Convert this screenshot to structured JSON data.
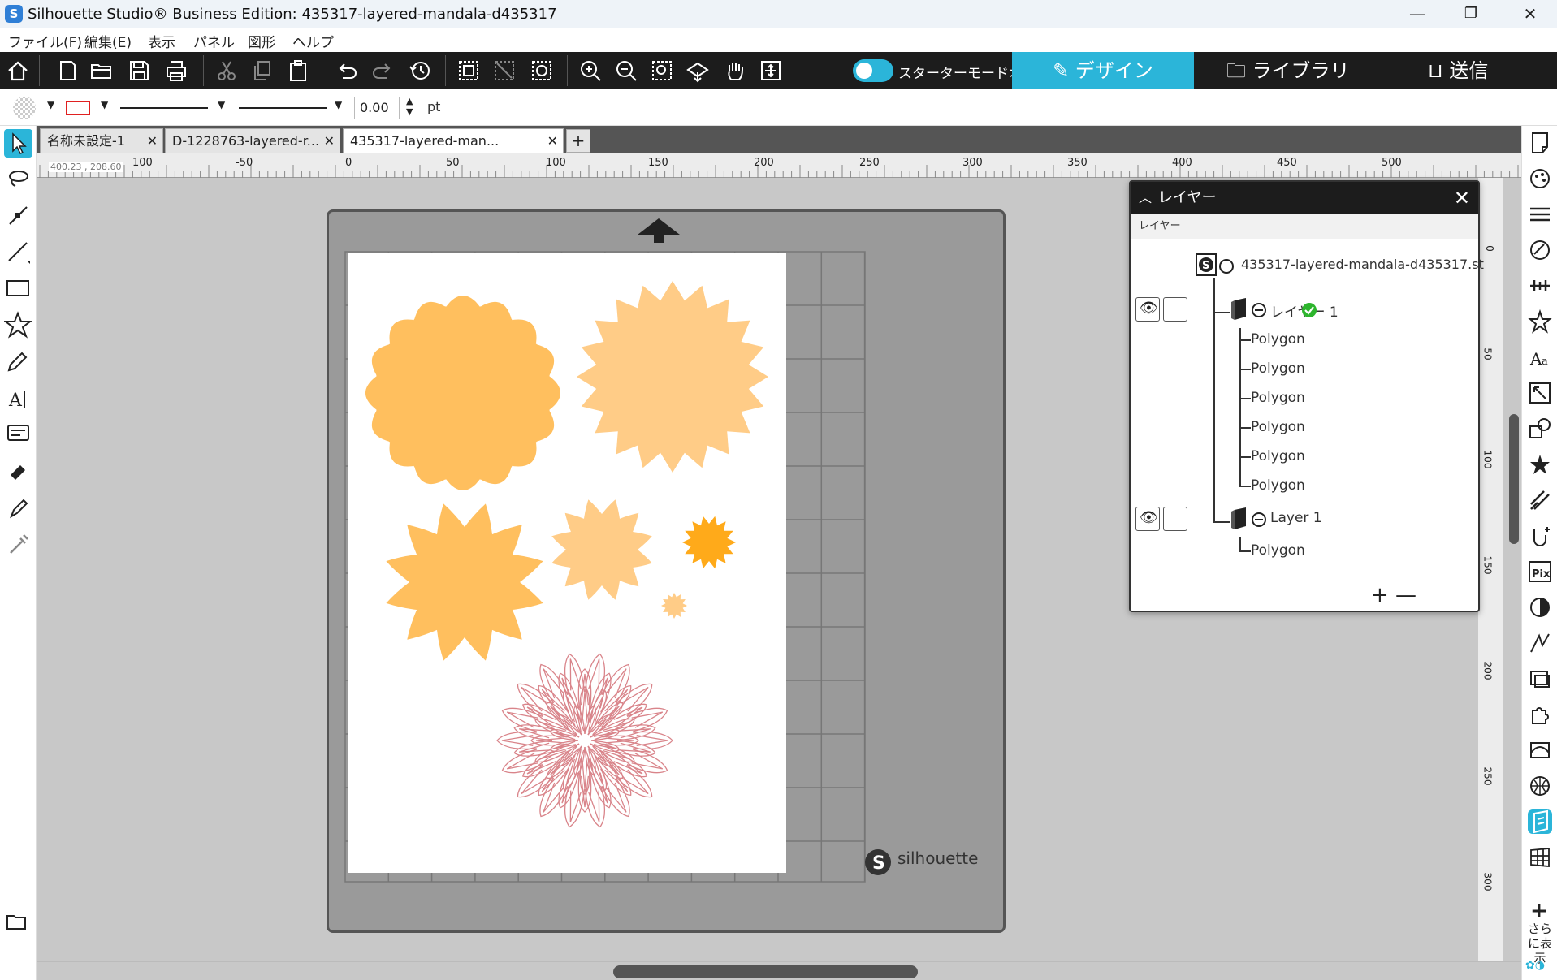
{
  "titlebar": {
    "title": "Silhouette Studio® Business Edition: 435317-layered-mandala-d435317",
    "minimize": "—",
    "maximize": "❐",
    "close": "✕"
  },
  "menu": {
    "file": "ファイル(F)",
    "edit": "編集(E)",
    "view": "表示",
    "panel": "パネル",
    "shape": "図形",
    "help": "ヘルプ"
  },
  "toolbar": {
    "starter_mode_label": "スターターモードオフ",
    "design": "デザイン",
    "library": "ライブラリ",
    "send": "送信"
  },
  "properties": {
    "line_width": "0.00",
    "unit": "pt"
  },
  "ruler": {
    "coordinate": "400.23 , 208.60",
    "h_ticks": [
      "100",
      "-50",
      "0",
      "50",
      "100",
      "150",
      "200",
      "250",
      "300",
      "350",
      "400",
      "450",
      "500"
    ],
    "v_ticks": [
      "0",
      "50",
      "100",
      "150",
      "200",
      "250",
      "300"
    ]
  },
  "doc_tabs": [
    {
      "label": "名称未設定-1",
      "active": false
    },
    {
      "label": "D-1228763-layered-r...",
      "active": false
    },
    {
      "label": "435317-layered-man...",
      "active": true
    }
  ],
  "add_tab": "+",
  "layers_panel": {
    "title": "レイヤー",
    "subtitle": "レイヤー",
    "file_name": "435317-layered-mandala-d435317.st",
    "layer1": {
      "name": "レイヤー 1",
      "children": [
        "Polygon",
        "Polygon",
        "Polygon",
        "Polygon",
        "Polygon",
        "Polygon"
      ]
    },
    "layer2": {
      "name": "Layer 1",
      "children": [
        "Polygon"
      ]
    },
    "add": "+",
    "remove": "—"
  },
  "mat": {
    "brand": "silhouette"
  },
  "right_panel": {
    "more_label": "さらに表示"
  },
  "colors": {
    "accent": "#2bb5d9",
    "toolbar_bg": "#1c1c1c",
    "shape_orange": "#ffbf5e",
    "shape_light": "#ffcc87",
    "shape_dark": "#ffaa1a",
    "mandala_line": "#d9848a"
  }
}
